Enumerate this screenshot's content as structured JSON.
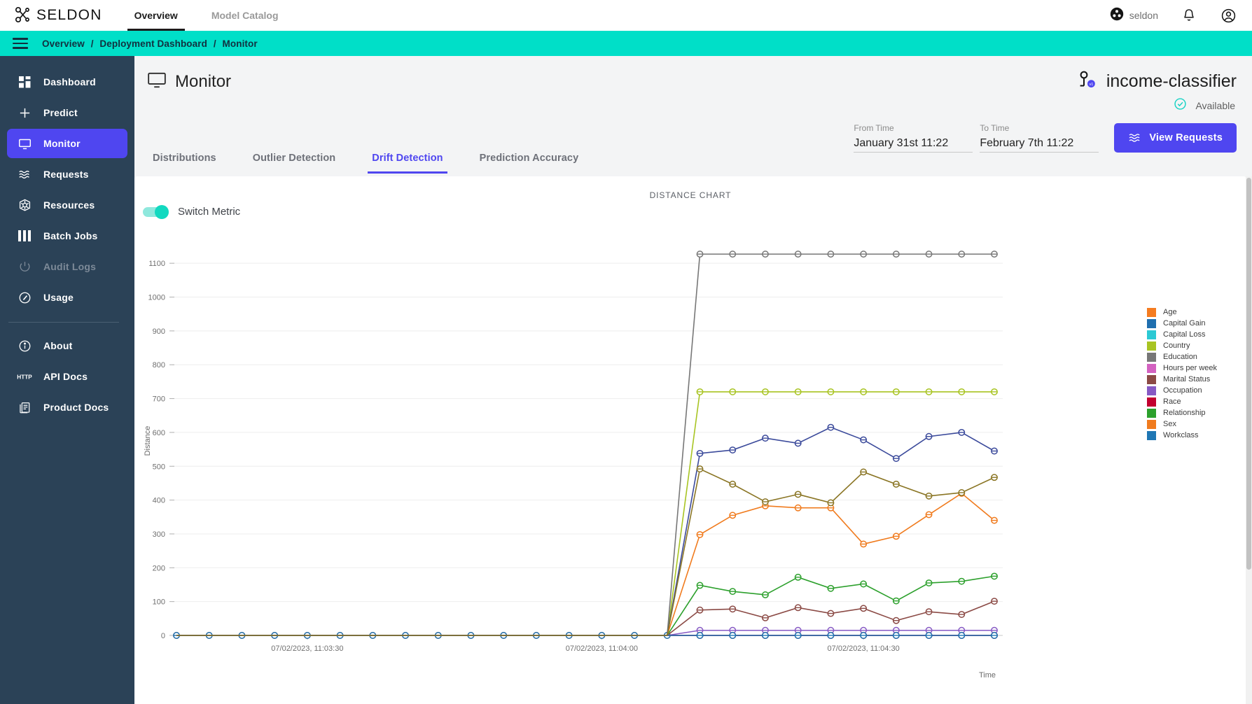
{
  "topnav": {
    "brand": "SELDON",
    "brand_logo_icon": "seldon-logo-icon",
    "tabs": [
      {
        "label": "Overview",
        "active": true
      },
      {
        "label": "Model Catalog",
        "active": false
      }
    ],
    "org": {
      "name": "seldon",
      "icon": "org-avatar-icon"
    },
    "notifications_icon": "bell-icon",
    "account_icon": "user-circle-icon"
  },
  "breadcrumb": {
    "menu_icon": "hamburger-icon",
    "items": [
      "Overview",
      "Deployment Dashboard",
      "Monitor"
    ],
    "separator": "/"
  },
  "sidebar": {
    "items": [
      {
        "label": "Dashboard",
        "icon": "dashboard-grid-icon",
        "active": false,
        "disabled": false
      },
      {
        "label": "Predict",
        "icon": "plus-icon",
        "active": false,
        "disabled": false
      },
      {
        "label": "Monitor",
        "icon": "monitor-screen-icon",
        "active": true,
        "disabled": false
      },
      {
        "label": "Requests",
        "icon": "waves-icon",
        "active": false,
        "disabled": false
      },
      {
        "label": "Resources",
        "icon": "kubernetes-icon",
        "active": false,
        "disabled": false
      },
      {
        "label": "Batch Jobs",
        "icon": "bars-icon",
        "active": false,
        "disabled": false
      },
      {
        "label": "Audit Logs",
        "icon": "power-icon",
        "active": false,
        "disabled": true
      },
      {
        "label": "Usage",
        "icon": "gauge-icon",
        "active": false,
        "disabled": false
      }
    ],
    "footer_items": [
      {
        "label": "About",
        "icon": "info-circle-icon"
      },
      {
        "label": "API Docs",
        "icon": "http-text-icon"
      },
      {
        "label": "Product Docs",
        "icon": "docs-icon"
      }
    ]
  },
  "page": {
    "title": "Monitor",
    "title_icon": "monitor-screen-icon",
    "model_name": "income-classifier",
    "model_icon": "model-version-icon",
    "status": "Available",
    "status_icon": "check-circle-icon",
    "status_color": "#19d3c5"
  },
  "date_range": {
    "from_label": "From Time",
    "from_value": "January 31st 11:22",
    "to_label": "To Time",
    "to_value": "February 7th 11:22"
  },
  "view_requests_button": {
    "label": "View Requests",
    "icon": "waves-icon",
    "color": "#4f46f0"
  },
  "tabs": [
    {
      "label": "Distributions",
      "active": false
    },
    {
      "label": "Outlier Detection",
      "active": false
    },
    {
      "label": "Drift Detection",
      "active": true
    },
    {
      "label": "Prediction Accuracy",
      "active": false
    }
  ],
  "switch_metric": {
    "label": "Switch Metric",
    "enabled": true,
    "color": "#12d9c0"
  },
  "accent_color": "#4f46f0",
  "crumb_bar_color": "#00dfc8",
  "chart_data": {
    "type": "line",
    "title": "DISTANCE CHART",
    "xlabel": "Time",
    "ylabel": "Distance",
    "ylim": [
      0,
      1150
    ],
    "yticks": [
      0,
      100,
      200,
      300,
      400,
      500,
      600,
      700,
      800,
      900,
      1000,
      1100
    ],
    "grid": true,
    "legend_position": "right",
    "x_tick_labels": [
      "07/02/2023, 11:03:30",
      "07/02/2023, 11:04:00",
      "07/02/2023, 11:04:30"
    ],
    "x_tick_indices": [
      4,
      13,
      21
    ],
    "n_points": 26,
    "series": [
      {
        "name": "Age",
        "color": "#F57C20",
        "values": [
          0,
          0,
          0,
          0,
          0,
          0,
          0,
          0,
          0,
          0,
          0,
          0,
          0,
          0,
          0,
          0,
          0,
          0,
          0,
          0,
          0,
          0,
          0,
          0,
          0,
          0
        ]
      },
      {
        "name": "Capital Gain",
        "color": "#1F6FAF",
        "values": [
          0,
          0,
          0,
          0,
          0,
          0,
          0,
          0,
          0,
          0,
          0,
          0,
          0,
          0,
          0,
          0,
          0,
          0,
          0,
          0,
          0,
          0,
          0,
          0,
          0,
          0
        ]
      },
      {
        "name": "Capital Loss",
        "color": "#2BC9D4",
        "values": [
          0,
          0,
          0,
          0,
          0,
          0,
          0,
          0,
          0,
          0,
          0,
          0,
          0,
          0,
          0,
          0,
          0,
          0,
          0,
          0,
          0,
          0,
          0,
          0,
          0,
          0
        ]
      },
      {
        "name": "Country",
        "color": "#A8C422",
        "values": [
          0,
          0,
          0,
          0,
          0,
          0,
          0,
          0,
          0,
          0,
          0,
          0,
          0,
          0,
          0,
          0,
          720,
          720,
          720,
          720,
          720,
          720,
          720,
          720,
          720,
          720
        ]
      },
      {
        "name": "Education",
        "color": "#777777",
        "values": [
          0,
          0,
          0,
          0,
          0,
          0,
          0,
          0,
          0,
          0,
          0,
          0,
          0,
          0,
          0,
          0,
          1127,
          1127,
          1127,
          1127,
          1127,
          1127,
          1127,
          1127,
          1127,
          1127
        ]
      },
      {
        "name": "Hours per week",
        "color": "#D362C0",
        "values": [
          0,
          0,
          0,
          0,
          0,
          0,
          0,
          0,
          0,
          0,
          0,
          0,
          0,
          0,
          0,
          0,
          0,
          0,
          0,
          0,
          0,
          0,
          0,
          0,
          0,
          0
        ]
      },
      {
        "name": "Marital Status",
        "color": "#8B4A45",
        "values": [
          0,
          0,
          0,
          0,
          0,
          0,
          0,
          0,
          0,
          0,
          0,
          0,
          0,
          0,
          0,
          0,
          75,
          78,
          52,
          82,
          65,
          80,
          44,
          70,
          62,
          101
        ]
      },
      {
        "name": "Occupation",
        "color": "#8659C4",
        "values": [
          0,
          0,
          0,
          0,
          0,
          0,
          0,
          0,
          0,
          0,
          0,
          0,
          0,
          0,
          0,
          0,
          15,
          15,
          15,
          15,
          15,
          15,
          15,
          15,
          15,
          15
        ]
      },
      {
        "name": "Race",
        "color": "#C2002F",
        "values": [
          0,
          0,
          0,
          0,
          0,
          0,
          0,
          0,
          0,
          0,
          0,
          0,
          0,
          0,
          0,
          0,
          0,
          0,
          0,
          0,
          0,
          0,
          0,
          0,
          0,
          0
        ]
      },
      {
        "name": "Relationship",
        "color": "#2CA02C",
        "values": [
          0,
          0,
          0,
          0,
          0,
          0,
          0,
          0,
          0,
          0,
          0,
          0,
          0,
          0,
          0,
          0,
          148,
          130,
          120,
          172,
          139,
          152,
          102,
          155,
          160,
          175
        ]
      },
      {
        "name": "Sex",
        "color": "#F07B1E",
        "values": [
          0,
          0,
          0,
          0,
          0,
          0,
          0,
          0,
          0,
          0,
          0,
          0,
          0,
          0,
          0,
          0,
          298,
          355,
          383,
          377,
          377,
          270,
          293,
          357,
          420,
          340
        ]
      },
      {
        "name": "Workclass",
        "color": "#1F77B4",
        "values": [
          0,
          0,
          0,
          0,
          0,
          0,
          0,
          0,
          0,
          0,
          0,
          0,
          0,
          0,
          0,
          0,
          0,
          0,
          0,
          0,
          0,
          0,
          0,
          0,
          0,
          0
        ]
      }
    ],
    "plotted_extra_series": [
      {
        "name": "navy-series",
        "color": "#3B4A9B",
        "values": [
          0,
          0,
          0,
          0,
          0,
          0,
          0,
          0,
          0,
          0,
          0,
          0,
          0,
          0,
          0,
          0,
          538,
          548,
          583,
          568,
          615,
          578,
          523,
          588,
          600,
          545
        ]
      },
      {
        "name": "olive-series",
        "color": "#8A7524",
        "values": [
          0,
          0,
          0,
          0,
          0,
          0,
          0,
          0,
          0,
          0,
          0,
          0,
          0,
          0,
          0,
          0,
          492,
          447,
          395,
          417,
          392,
          483,
          447,
          412,
          422,
          467
        ]
      }
    ]
  }
}
